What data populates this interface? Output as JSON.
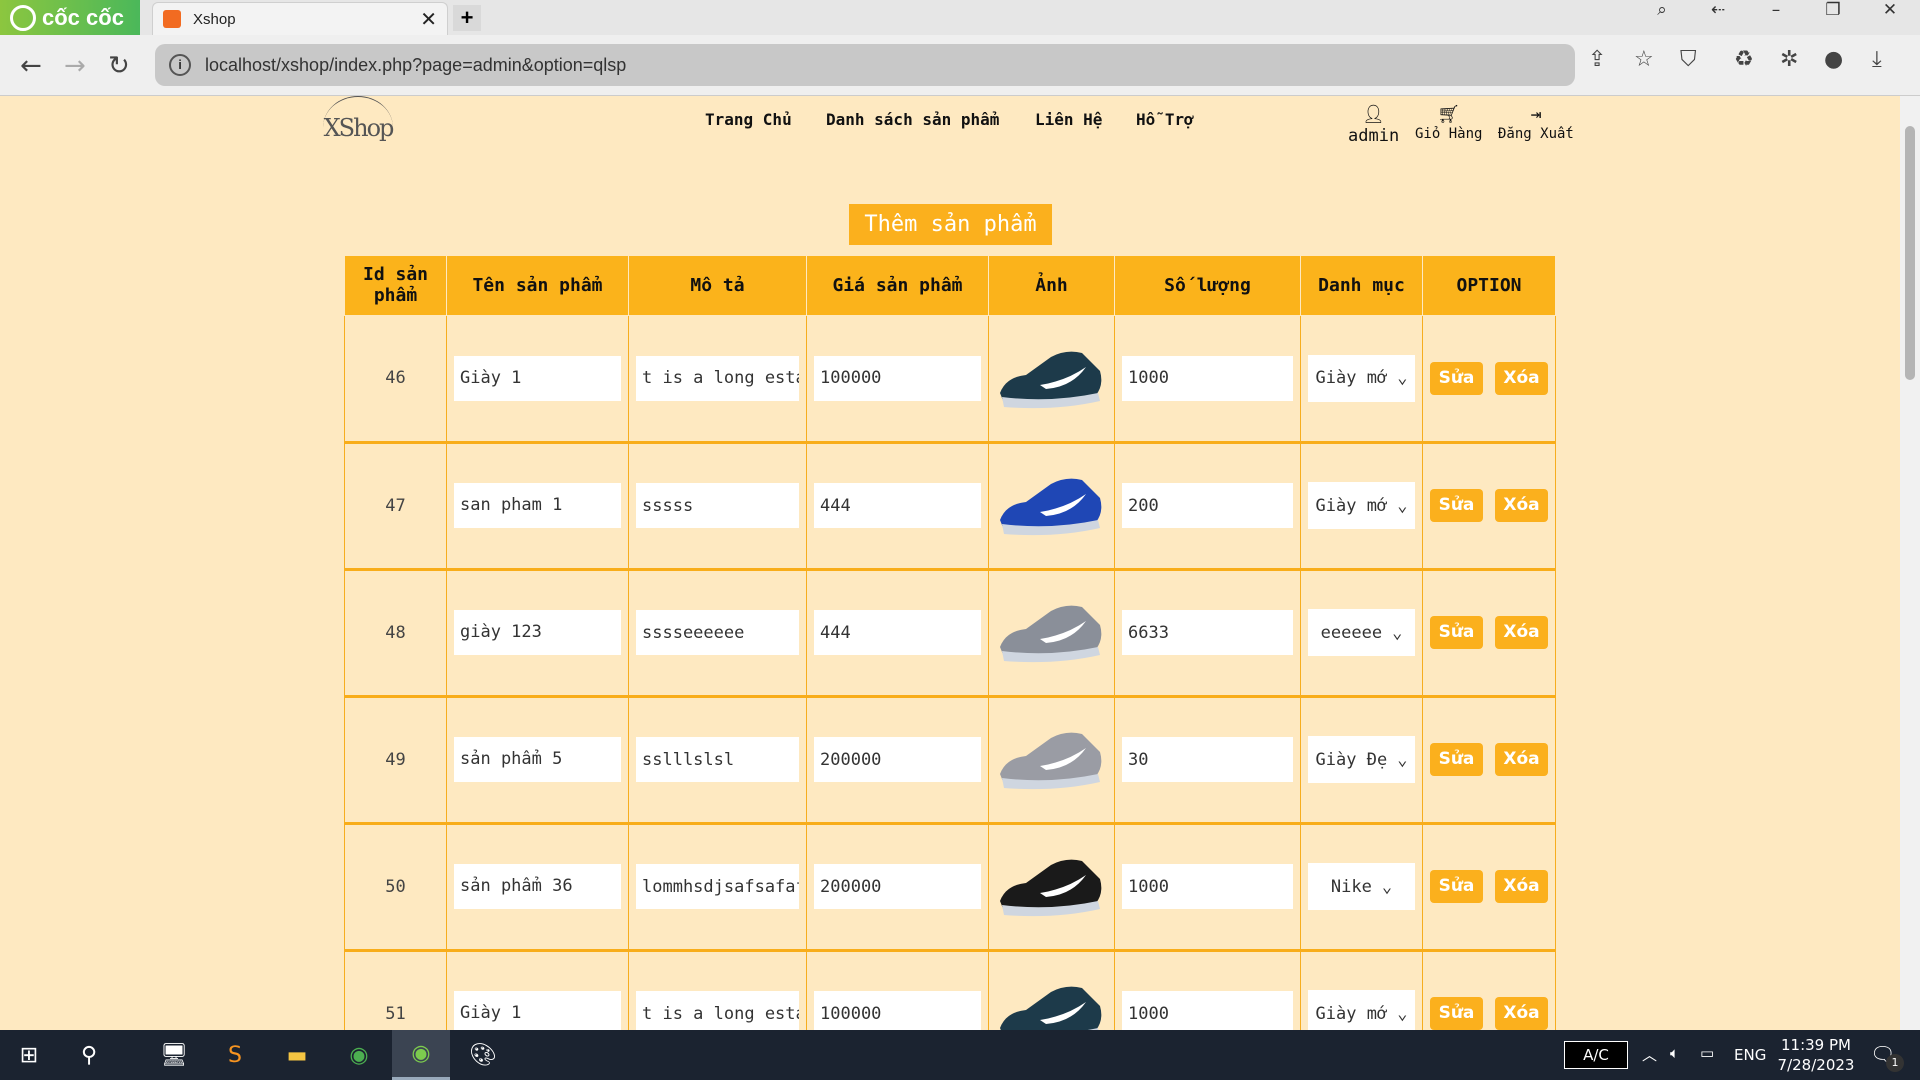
{
  "browser": {
    "brand": "cốc cốc",
    "tab_title": "Xshop",
    "url": "localhost/xshop/index.php?page=admin&option=qlsp"
  },
  "site": {
    "logo": "XShop",
    "menu": [
      "Trang Chủ",
      "Danh sách sản phẩm",
      "Liên Hệ",
      "Hỗ Trợ"
    ],
    "user": "admin",
    "cart": "Giỏ Hàng",
    "logout": "Đăng Xuất"
  },
  "main": {
    "add_button": "Thêm sản phẩm",
    "headers": [
      "Id sản phẩm",
      "Tên sản phẩm",
      "Mô tả",
      "Giá sản phẩm",
      "Ảnh",
      "Số lượng",
      "Danh mục",
      "OPTION"
    ],
    "edit_label": "Sửa",
    "delete_label": "Xóa",
    "rows": [
      {
        "id": "46",
        "name": "Giày 1",
        "desc": "t is a long esta",
        "price": "100000",
        "qty": "1000",
        "category": "Giày mớ",
        "shoe": "#1d3a4a"
      },
      {
        "id": "47",
        "name": "san pham 1",
        "desc": "sssss",
        "price": "444",
        "qty": "200",
        "category": "Giày mớ",
        "shoe": "#1f47b5"
      },
      {
        "id": "48",
        "name": "giày 123",
        "desc": "sssseeeeee",
        "price": "444",
        "qty": "6633",
        "category": "eeeeee",
        "shoe": "#8a8f99"
      },
      {
        "id": "49",
        "name": "sản phẩm 5",
        "desc": "sslllslsl",
        "price": "200000",
        "qty": "30",
        "category": "Giày Đẹ",
        "shoe": "#9a9ca4"
      },
      {
        "id": "50",
        "name": "sản phẩm 36",
        "desc": "lommhsdjsafsafaf",
        "price": "200000",
        "qty": "1000",
        "category": "Nike",
        "shoe": "#1a1a1a"
      },
      {
        "id": "51",
        "name": "Giày 1",
        "desc": "t is a long esta",
        "price": "100000",
        "qty": "1000",
        "category": "Giày mớ",
        "shoe": "#1d3a4a"
      }
    ]
  },
  "taskbar": {
    "ac": "A/C",
    "lang": "ENG",
    "time": "11:39 PM",
    "date": "7/28/2023",
    "notif": "1"
  }
}
